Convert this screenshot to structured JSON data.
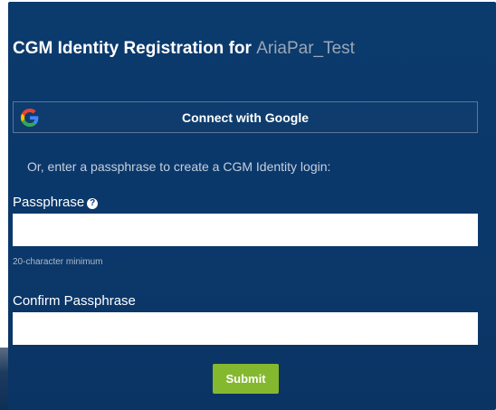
{
  "header": {
    "title_prefix": "CGM Identity Registration for",
    "app_name": "AriaPar_Test"
  },
  "google": {
    "label": "Connect with Google",
    "icon": "google-g-icon"
  },
  "divider_text": "Or, enter a passphrase to create a CGM Identity login:",
  "passphrase": {
    "label": "Passphrase",
    "help_icon": "question-circle-icon",
    "help_glyph": "?",
    "value": "",
    "hint": "20-character minimum"
  },
  "confirm": {
    "label": "Confirm Passphrase",
    "value": ""
  },
  "submit": {
    "label": "Submit"
  },
  "colors": {
    "panel": "#0b3a6d",
    "submit": "#84b82f",
    "app_name": "#9aa7b6"
  }
}
